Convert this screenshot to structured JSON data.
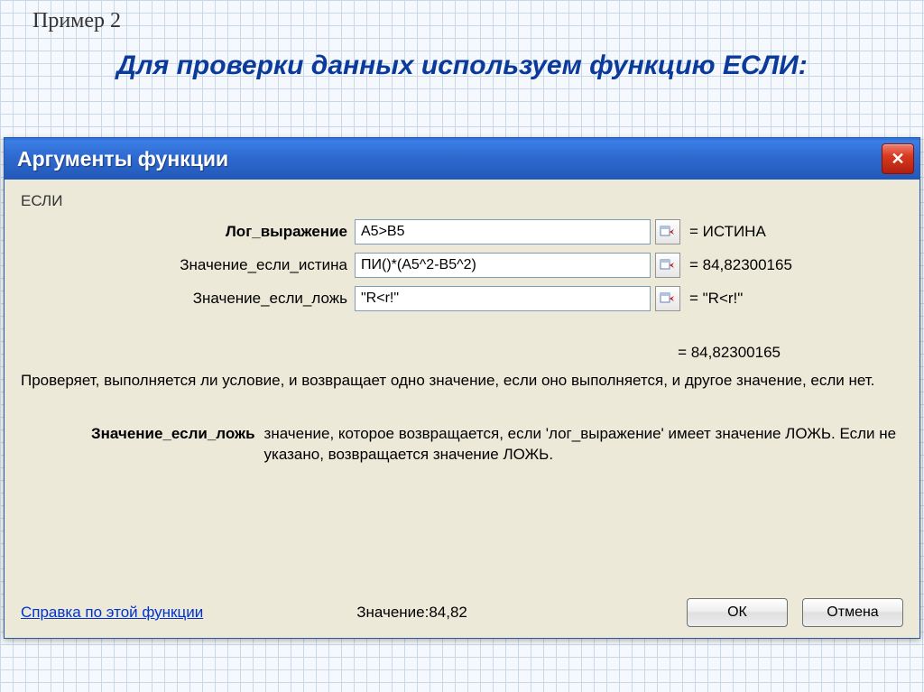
{
  "slide": {
    "label": "Пример 2",
    "title": "Для проверки данных  используем функцию ЕСЛИ:"
  },
  "dialog": {
    "title": "Аргументы функции",
    "function_name": "ЕСЛИ",
    "args": [
      {
        "label": "Лог_выражение",
        "value": "A5>B5",
        "result": "= ИСТИНА"
      },
      {
        "label": "Значение_если_истина",
        "value": "ПИ()*(A5^2-B5^2)",
        "result": "= 84,82300165"
      },
      {
        "label": "Значение_если_ложь",
        "value": "\"R<r!\"",
        "result": "= \"R<r!\""
      }
    ],
    "overall_result": "= 84,82300165",
    "description": "Проверяет, выполняется ли условие, и возвращает одно значение, если оно выполняется, и другое значение, если нет.",
    "param_name": "Значение_если_ложь",
    "param_expl": "значение, которое возвращается, если 'лог_выражение' имеет значение ЛОЖЬ. Если не указано, возвращается значение ЛОЖЬ.",
    "help_link": "Справка по этой функции",
    "result_label": "Значение:",
    "result_value": "84,82",
    "ok": "ОК",
    "cancel": "Отмена"
  }
}
